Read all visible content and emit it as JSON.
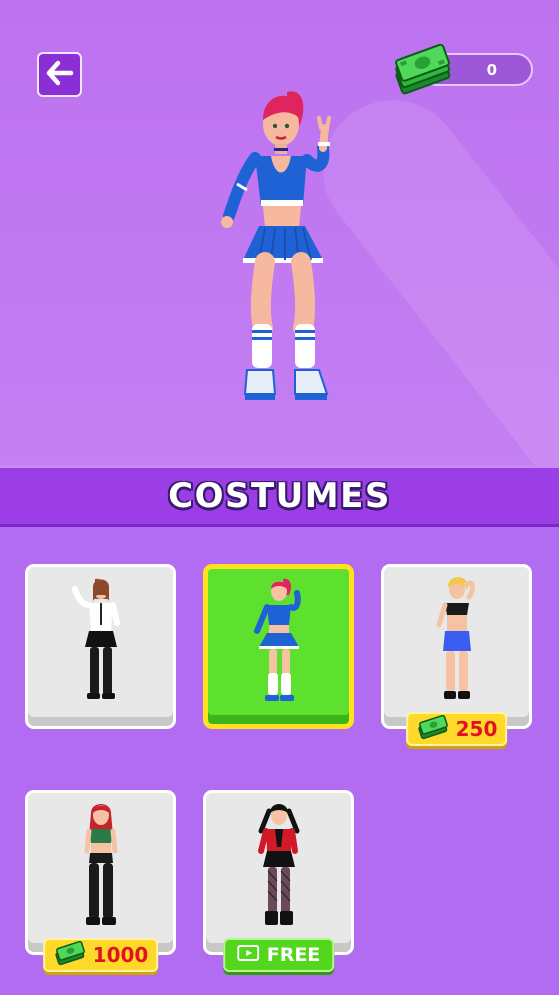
{
  "header": {
    "back_icon": "arrow-left-icon",
    "currency_icon": "cash-stack-icon",
    "currency_amount": "0"
  },
  "preview": {
    "character": "cheerleader-outfit-blue"
  },
  "banner": {
    "title": "COSTUMES"
  },
  "costumes": [
    {
      "outfit": "office-white-shirt-black-skirt",
      "selected": false,
      "status": "owned"
    },
    {
      "outfit": "cheerleader-blue",
      "selected": true,
      "status": "owned"
    },
    {
      "outfit": "sport-top-blue-shorts",
      "selected": false,
      "status": "buy",
      "price": "250"
    },
    {
      "outfit": "green-top-black-leggings",
      "selected": false,
      "status": "buy",
      "price": "1000"
    },
    {
      "outfit": "gothic-red-jacket",
      "selected": false,
      "status": "ad",
      "label": "FREE"
    }
  ],
  "colors": {
    "background": "#b26cf2",
    "banner": "#9b3ee6",
    "selected_card": "#5ee02e",
    "selected_border": "#ffe11c",
    "price_tag": "#ffd92a",
    "price_text": "#e0141e",
    "free_tag": "#55d61e"
  }
}
